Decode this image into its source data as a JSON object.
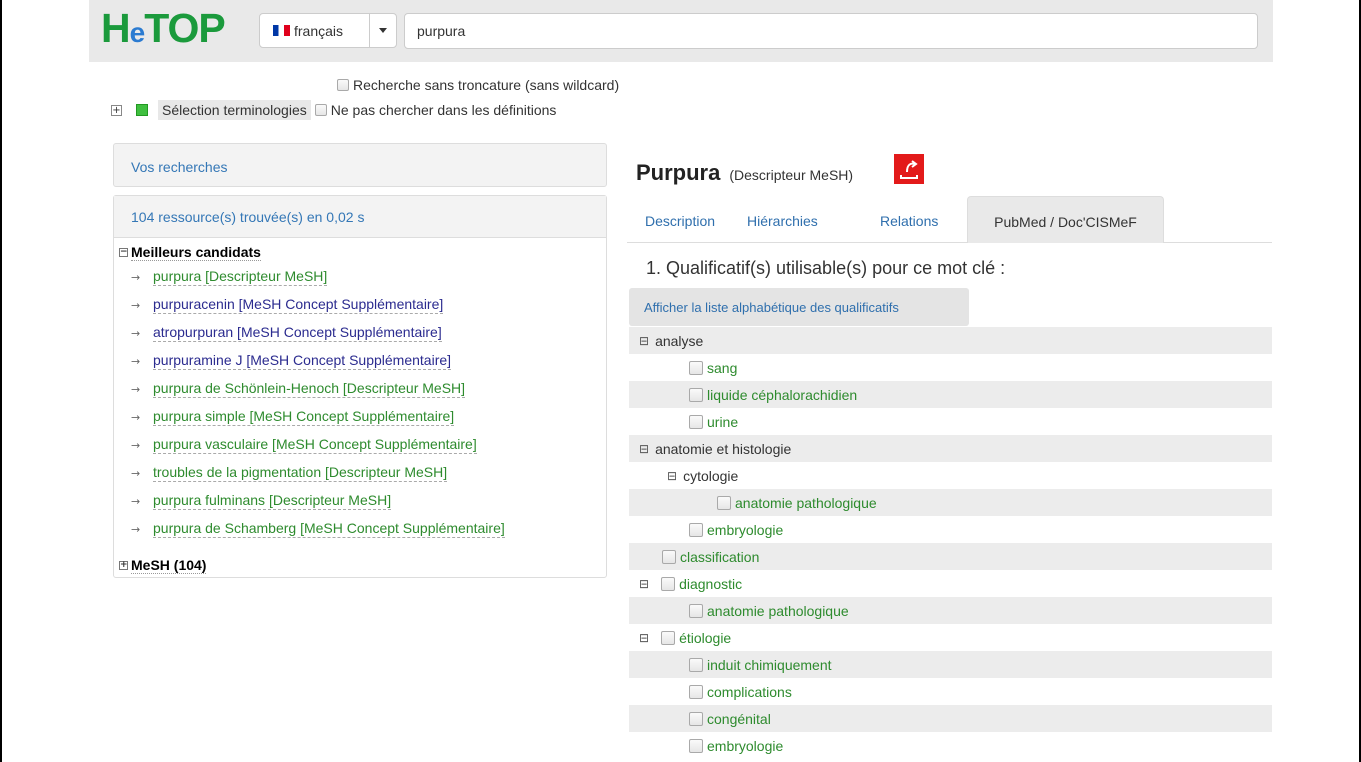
{
  "header": {
    "logo_main": "H",
    "logo_e": "e",
    "logo_rest": "TOP",
    "language": "français",
    "search_value": "purpura"
  },
  "options": {
    "no_truncation": "Recherche sans troncature (sans wildcard)",
    "terminology_selection": "Sélection terminologies",
    "no_definitions": "Ne pas chercher dans les définitions"
  },
  "left": {
    "vos_recherches": "Vos recherches",
    "results_count": "104 ressource(s) trouvée(s) en 0,02 s",
    "best_candidates_title": "Meilleurs candidats",
    "candidates": [
      {
        "label": "purpura [Descripteur MeSH]",
        "color": "#2e8b2e"
      },
      {
        "label": "purpuracenin [MeSH Concept Supplémentaire]",
        "color": "#2b2b8f"
      },
      {
        "label": "atropurpuran [MeSH Concept Supplémentaire]",
        "color": "#2b2b8f"
      },
      {
        "label": "purpuramine J [MeSH Concept Supplémentaire]",
        "color": "#2b2b8f"
      },
      {
        "label": "purpura de Schönlein-Henoch [Descripteur MeSH]",
        "color": "#2e8b2e"
      },
      {
        "label": "purpura simple [MeSH Concept Supplémentaire]",
        "color": "#2e8b2e"
      },
      {
        "label": "purpura vasculaire [MeSH Concept Supplémentaire]",
        "color": "#2e8b2e"
      },
      {
        "label": "troubles de la pigmentation [Descripteur MeSH]",
        "color": "#2e8b2e"
      },
      {
        "label": "purpura fulminans [Descripteur MeSH]",
        "color": "#2e8b2e"
      },
      {
        "label": "purpura de Schamberg [MeSH Concept Supplémentaire]",
        "color": "#2e8b2e"
      }
    ],
    "mesh_group": "MeSH (104)"
  },
  "main": {
    "title": "Purpura",
    "subtype": "(Descripteur MeSH)",
    "pdf_icon": "pdf-icon",
    "tabs": [
      {
        "label": "Description"
      },
      {
        "label": "Hiérarchies"
      },
      {
        "label": "Relations"
      },
      {
        "label": "PubMed / Doc'CISMeF"
      }
    ],
    "qualifiers_heading": "1. Qualificatif(s) utilisable(s) pour ce mot clé :",
    "alpha_button": "Afficher la liste alphabétique des qualificatifs",
    "tree": [
      "analyse",
      "sang",
      "liquide céphalorachidien",
      "urine",
      "anatomie et histologie",
      "cytologie",
      "anatomie pathologique",
      "embryologie",
      "classification",
      "diagnostic",
      "anatomie pathologique",
      "étiologie",
      "induit chimiquement",
      "complications",
      "congénital",
      "embryologie"
    ]
  },
  "colors": {
    "brand_green": "#1b9a3c",
    "link_blue": "#2f6fad",
    "link_green": "#2e8b2e",
    "pdf_red": "#e31a1a"
  }
}
